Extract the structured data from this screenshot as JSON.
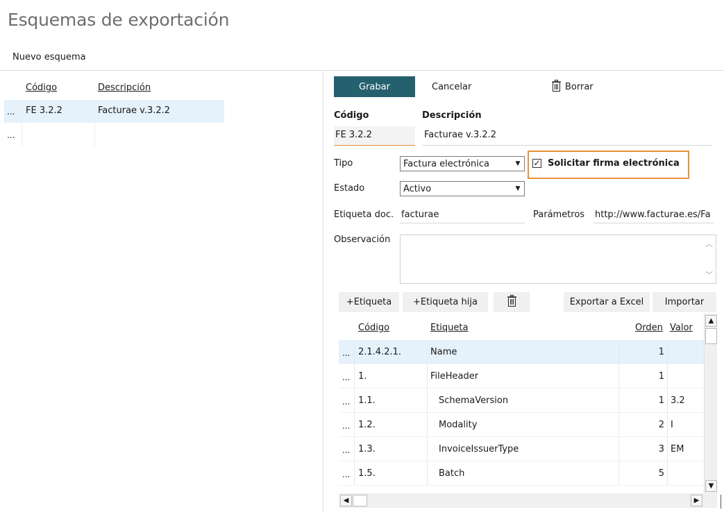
{
  "page": {
    "title": "Esquemas de exportación",
    "new_scheme": "Nuevo esquema"
  },
  "list": {
    "headers": {
      "code": "Código",
      "description": "Descripción"
    },
    "rows": [
      {
        "dots": "...",
        "code": "FE 3.2.2",
        "description": "Facturae v.3.2.2"
      },
      {
        "dots": "...",
        "code": "",
        "description": ""
      }
    ]
  },
  "toolbar": {
    "save": "Grabar",
    "cancel": "Cancelar",
    "delete": "Borrar",
    "delete_icon": "trash-icon"
  },
  "form": {
    "code_label": "Código",
    "code_value": "FE 3.2.2",
    "description_label": "Descripción",
    "description_value": "Facturae v.3.2.2",
    "type_label": "Tipo",
    "type_value": "Factura electrónica",
    "signature_label": "Solicitar firma electrónica",
    "signature_checked": true,
    "status_label": "Estado",
    "status_value": "Activo",
    "doc_tag_label": "Etiqueta doc.",
    "doc_tag_value": "facturae",
    "params_label": "Parámetros",
    "params_value": "http://www.facturae.es/Fa",
    "notes_label": "Observación",
    "notes_value": ""
  },
  "tags_toolbar": {
    "add_tag": "+Etiqueta",
    "add_child_tag": "+Etiqueta hija",
    "export_excel": "Exportar a Excel",
    "import": "Importar"
  },
  "grid": {
    "headers": {
      "code": "Código",
      "tag": "Etiqueta",
      "order": "Orden",
      "value": "Valor"
    },
    "rows": [
      {
        "dots": "...",
        "code": "2.1.4.2.1.",
        "tag": "Name",
        "order": "1",
        "value": "",
        "indent": 0
      },
      {
        "dots": "...",
        "code": "1.",
        "tag": "FileHeader",
        "order": "1",
        "value": "",
        "indent": 0
      },
      {
        "dots": "...",
        "code": "1.1.",
        "tag": "SchemaVersion",
        "order": "1",
        "value": "3.2",
        "indent": 1
      },
      {
        "dots": "...",
        "code": "1.2.",
        "tag": "Modality",
        "order": "2",
        "value": "I",
        "indent": 1
      },
      {
        "dots": "...",
        "code": "1.3.",
        "tag": "InvoiceIssuerType",
        "order": "3",
        "value": "EM",
        "indent": 1
      },
      {
        "dots": "...",
        "code": "1.5.",
        "tag": "Batch",
        "order": "5",
        "value": "",
        "indent": 1
      }
    ]
  },
  "colors": {
    "primary": "#25606e",
    "highlight": "#e69138",
    "selection": "#e5f1fb"
  }
}
